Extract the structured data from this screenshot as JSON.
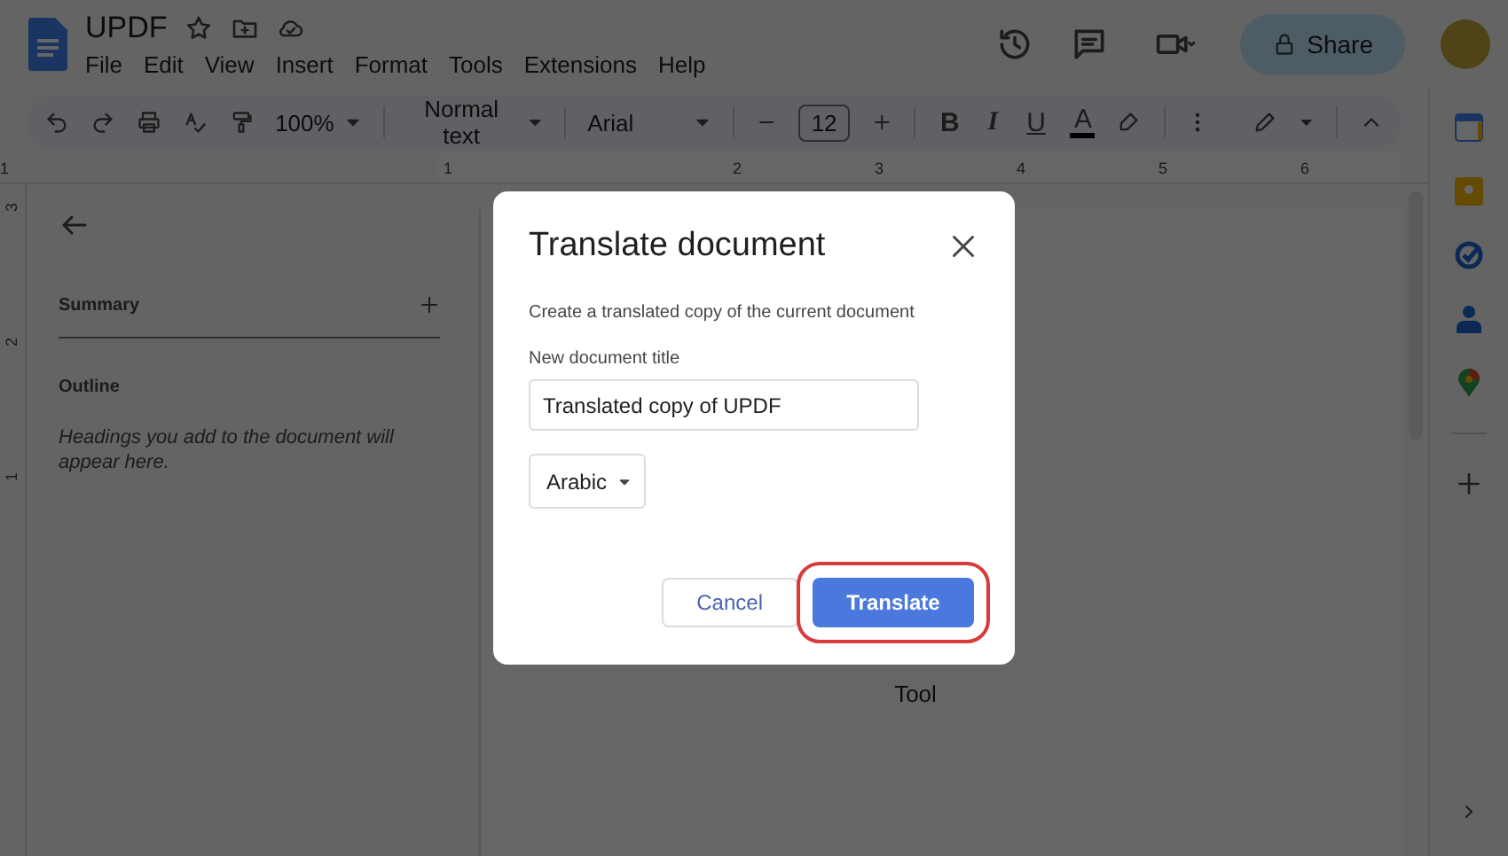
{
  "document": {
    "title": "UPDF"
  },
  "menu": [
    "File",
    "Edit",
    "View",
    "Insert",
    "Format",
    "Tools",
    "Extensions",
    "Help"
  ],
  "share_button": {
    "label": "Share"
  },
  "toolbar": {
    "zoom": "100%",
    "style": "Normal text",
    "font": "Arial",
    "font_size": "12",
    "format_buttons": [
      "B",
      "I",
      "U",
      "A"
    ]
  },
  "ruler": {
    "horizontal": [
      "1",
      "1",
      "2",
      "3",
      "4",
      "5",
      "6"
    ],
    "vertical": [
      "3",
      "2",
      "1"
    ]
  },
  "outline_panel": {
    "summary_label": "Summary",
    "outline_label": "Outline",
    "outline_hint": "Headings you add to the document will appear here."
  },
  "page": {
    "text": "Tool"
  },
  "dialog": {
    "title": "Translate document",
    "description": "Create a translated copy of the current document",
    "field_label": "New document title",
    "title_value": "Translated copy of UPDF",
    "language": "Arabic",
    "buttons": [
      {
        "label": "Cancel",
        "kind": "secondary",
        "highlighted": false
      },
      {
        "label": "Translate",
        "kind": "primary",
        "highlighted": true
      }
    ]
  }
}
